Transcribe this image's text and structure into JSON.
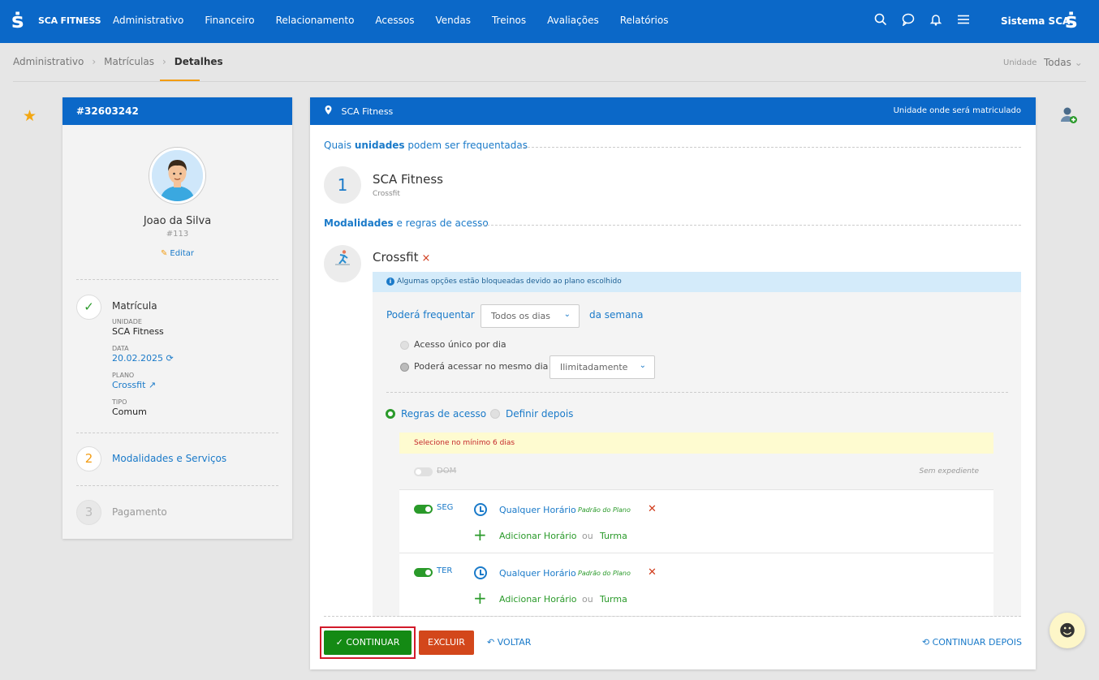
{
  "topbar": {
    "brand": "SCA FITNESS",
    "nav": [
      "Administrativo",
      "Financeiro",
      "Relacionamento",
      "Acessos",
      "Vendas",
      "Treinos",
      "Avaliações",
      "Relatórios"
    ],
    "system_label": "Sistema SCA",
    "icons": [
      "search-icon",
      "chat-icon",
      "bell-icon",
      "menu-icon"
    ]
  },
  "breadcrumb": [
    "Administrativo",
    "Matrículas",
    "Detalhes"
  ],
  "unidade": {
    "label": "Unidade",
    "value": "Todas"
  },
  "profile": {
    "card_id": "#32603242",
    "name": "Joao da Silva",
    "code": "#113",
    "edit_label": "Editar"
  },
  "steps": {
    "step1": {
      "title": "Matrícula",
      "fields": [
        {
          "key": "UNIDADE",
          "value": "SCA Fitness"
        },
        {
          "key": "DATA",
          "value": "20.02.2025"
        },
        {
          "key": "PLANO",
          "value": "Crossfit"
        },
        {
          "key": "TIPO",
          "value": "Comum"
        }
      ]
    },
    "step2": {
      "num": "2",
      "title": "Modalidades e Serviços"
    },
    "step3": {
      "num": "3",
      "title": "Pagamento"
    }
  },
  "main": {
    "header_title": "SCA Fitness",
    "header_right": "Unidade onde será matriculado",
    "section1": {
      "bold": "unidades",
      "pre": "Quais ",
      "post": " podem ser frequentadas"
    },
    "unit": {
      "num": "1",
      "name": "SCA Fitness",
      "sub": "Crossfit"
    },
    "section2": {
      "bold": "Modalidades",
      "post": " e regras de acesso"
    },
    "modality": {
      "name": "Crossfit",
      "remove": "×"
    },
    "info": "Algumas opções estão bloqueadas devido ao plano escolhido",
    "frequentar_label": "Poderá frequentar",
    "frequentar_value": "Todos os dias",
    "semana_label": "da semana",
    "access_options": [
      "Acesso único por dia",
      "Poderá acessar no mesmo dia"
    ],
    "access_select": "Ilimitadamente",
    "rule_options": [
      "Regras de acesso",
      "Definir depois"
    ],
    "warning": "Selecione no mínimo 6 dias",
    "dom": {
      "label": "DOM",
      "note": "Sem expediente"
    },
    "days": [
      {
        "label": "SEG",
        "time": "Qualquer Horário",
        "tag": "Padrão do Plano",
        "add": "Adicionar Horário",
        "or": "ou",
        "class": "Turma"
      },
      {
        "label": "TER",
        "time": "Qualquer Horário",
        "tag": "Padrão do Plano",
        "add": "Adicionar Horário",
        "or": "ou",
        "class": "Turma"
      }
    ]
  },
  "footer": {
    "continue": "CONTINUAR",
    "delete": "EXCLUIR",
    "back": "VOLTAR",
    "later": "CONTINUAR DEPOIS"
  },
  "colors": {
    "primary": "#0b68c8",
    "success": "#148a14",
    "danger": "#d3471b",
    "accent": "#f39c12"
  }
}
